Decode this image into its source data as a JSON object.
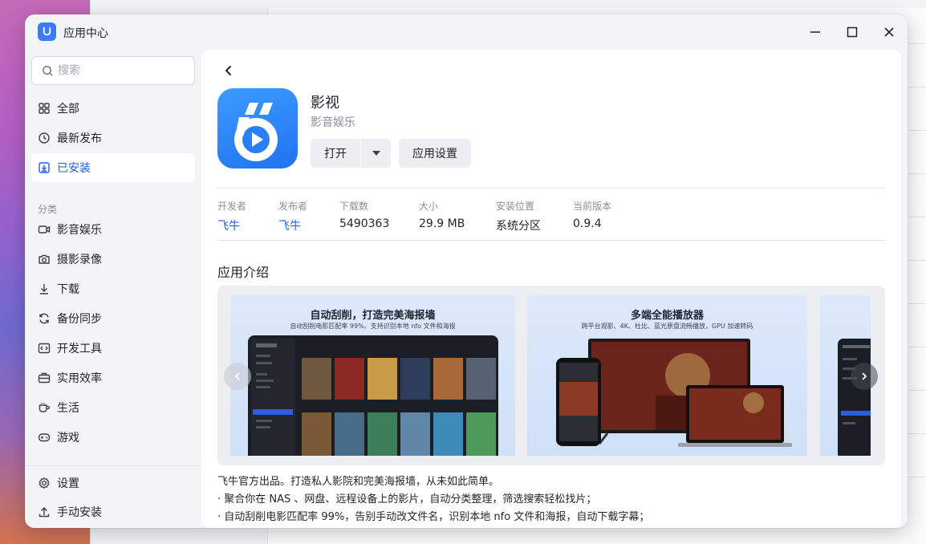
{
  "window": {
    "title": "应用中心",
    "logo_icon": "app-center-logo-icon",
    "controls": [
      "minimize-icon",
      "maximize-icon",
      "close-icon"
    ]
  },
  "sidebar": {
    "search_placeholder": "搜索",
    "top_items": [
      {
        "label": "全部",
        "icon": "grid-icon"
      },
      {
        "label": "最新发布",
        "icon": "clock-icon"
      },
      {
        "label": "已安装",
        "icon": "download-box-icon",
        "active": true
      }
    ],
    "section_label": "分类",
    "categories": [
      {
        "label": "影音娱乐",
        "icon": "video-camera-icon"
      },
      {
        "label": "摄影录像",
        "icon": "camera-icon"
      },
      {
        "label": "下载",
        "icon": "download-arrow-icon"
      },
      {
        "label": "备份同步",
        "icon": "sync-icon"
      },
      {
        "label": "开发工具",
        "icon": "code-icon"
      },
      {
        "label": "实用效率",
        "icon": "briefcase-icon"
      },
      {
        "label": "生活",
        "icon": "coffee-cup-icon"
      },
      {
        "label": "游戏",
        "icon": "gamepad-icon"
      }
    ],
    "footer_items": [
      {
        "label": "设置",
        "icon": "gear-icon"
      },
      {
        "label": "手动安装",
        "icon": "upload-icon"
      }
    ]
  },
  "app": {
    "name": "影视",
    "category": "影音娱乐",
    "open_label": "打开",
    "settings_label": "应用设置",
    "meta": [
      {
        "key": "开发者",
        "value": "飞牛",
        "link": true
      },
      {
        "key": "发布者",
        "value": "飞牛",
        "link": true
      },
      {
        "key": "下载数",
        "value": "5490363"
      },
      {
        "key": "大小",
        "value": "29.9 MB"
      },
      {
        "key": "安装位置",
        "value": "系统分区"
      },
      {
        "key": "当前版本",
        "value": "0.9.4"
      }
    ],
    "intro_title": "应用介绍",
    "screenshots": [
      {
        "title": "自动刮削，打造完美海报墙",
        "subtitle": "自动刮削电影匹配率 99%、支持识别本地 nfo 文件和海报"
      },
      {
        "title": "多端全能播放器",
        "subtitle": "跨平台观影、4K、杜比、蓝光原盘流畅播放，GPU 加速转码"
      }
    ],
    "description": [
      "飞牛官方出品。打造私人影院和完美海报墙，从未如此简单。",
      "· 聚合你在 NAS 、网盘、远程设备上的影片，自动分类整理，筛选搜索轻松找片；",
      "· 自动刮削电影匹配率 99%，告别手动改文件名，识别本地 nfo 文件和海报，自动下载字幕；"
    ]
  },
  "colors": {
    "accent": "#1a5ff0",
    "icon_blue": "#2a7ff5"
  }
}
